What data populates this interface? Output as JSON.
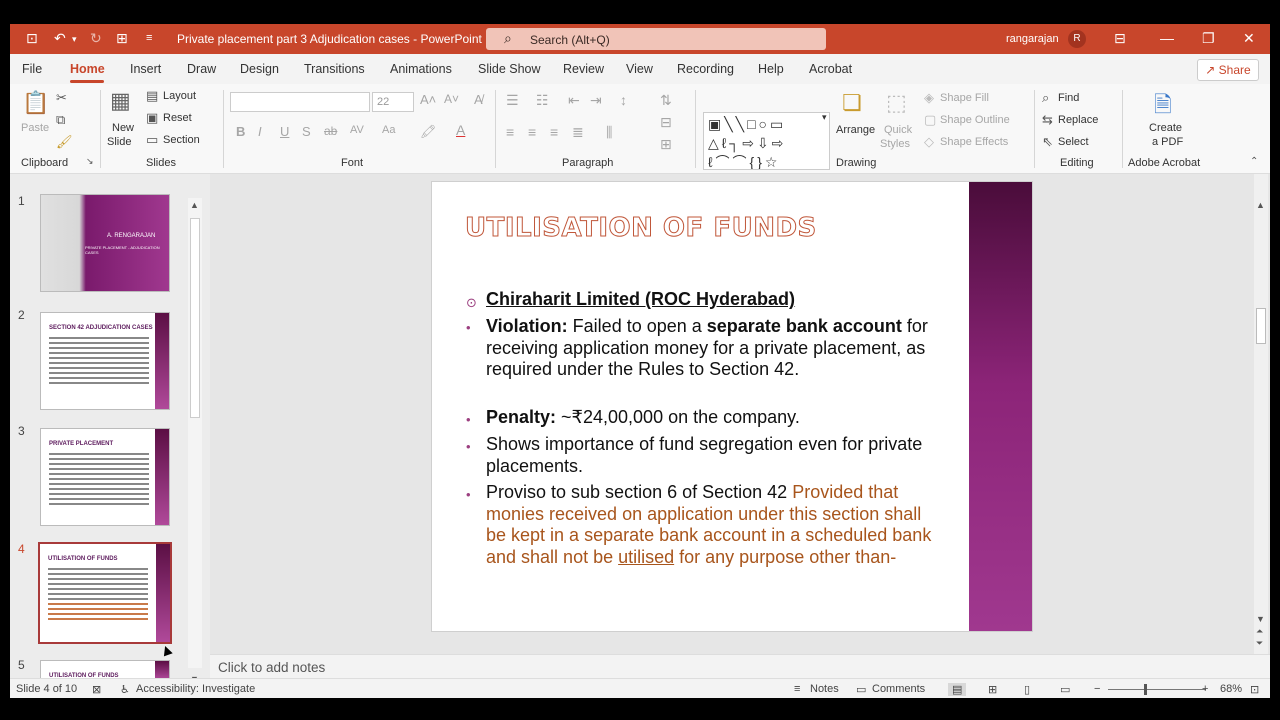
{
  "titlebar": {
    "doc_title": "Private placement  part  3  Adjudication cases  -  PowerPoint",
    "search_placeholder": "Search (Alt+Q)",
    "user_name": "rangarajan",
    "user_initial": "R"
  },
  "menu": {
    "tabs": [
      "File",
      "Home",
      "Insert",
      "Draw",
      "Design",
      "Transitions",
      "Animations",
      "Slide Show",
      "Review",
      "View",
      "Recording",
      "Help",
      "Acrobat"
    ],
    "active": "Home",
    "share": "Share"
  },
  "ribbon": {
    "clipboard": {
      "label": "Clipboard",
      "paste": "Paste"
    },
    "slides": {
      "label": "Slides",
      "new_slide_1": "New",
      "new_slide_2": "Slide",
      "layout": "Layout",
      "reset": "Reset",
      "section": "Section"
    },
    "font": {
      "label": "Font",
      "size": "22"
    },
    "paragraph": {
      "label": "Paragraph"
    },
    "drawing": {
      "label": "Drawing",
      "arrange": "Arrange",
      "quick_styles_1": "Quick",
      "quick_styles_2": "Styles",
      "shape_fill": "Shape Fill",
      "shape_outline": "Shape Outline",
      "shape_effects": "Shape Effects"
    },
    "editing": {
      "label": "Editing",
      "find": "Find",
      "replace": "Replace",
      "select": "Select"
    },
    "acrobat": {
      "label": "Adobe Acrobat",
      "create_1": "Create",
      "create_2": "a PDF"
    }
  },
  "thumbnails": [
    {
      "num": "1",
      "title": "A. RENGARAJAN",
      "subtitle": "PRIVATE PLACEMENT - ADJUDICATION CASES"
    },
    {
      "num": "2",
      "title": "SECTION 42 ADJUDICATION CASES"
    },
    {
      "num": "3",
      "title": "PRIVATE PLACEMENT"
    },
    {
      "num": "4",
      "title": "UTILISATION OF FUNDS"
    },
    {
      "num": "5",
      "title": "UTILISATION OF FUNDS"
    }
  ],
  "slide": {
    "title": "UTILISATION OF FUNDS",
    "b1": "Chiraharit Limited (ROC Hyderabad)",
    "b2_bold1": "Violation:",
    "b2_text1": " Failed to open a ",
    "b2_bold2": "separate bank account",
    "b2_text2": " for receiving application money for a private placement, as required under the Rules to Section 42.",
    "b3_bold": "Penalty:",
    "b3_text": " ~₹24,00,000 on the company.",
    "b4": "Shows importance of fund segregation even for private placements.",
    "b5_text": "Proviso  to sub section 6 of Section 42 ",
    "b5_orange1": "Provided that monies received on application under this section shall be kept in a separate bank account in a scheduled bank and shall not be ",
    "b5_underlined": "utilised",
    "b5_orange2": " for any purpose other than-"
  },
  "notes_placeholder": "Click to add notes",
  "status": {
    "slide_info": "Slide 4 of 10",
    "accessibility": "Accessibility: Investigate",
    "notes": "Notes",
    "comments": "Comments",
    "zoom": "68%"
  },
  "colors": {
    "accent": "#c8462b",
    "slide_bar": "#8c2478"
  }
}
